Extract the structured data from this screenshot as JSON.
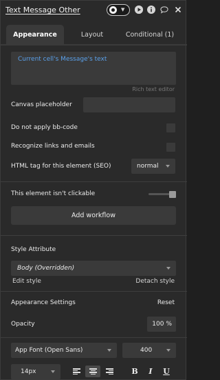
{
  "header": {
    "title": "Text Message Other",
    "icons": [
      "toggle-pill",
      "play-icon",
      "info-icon",
      "comment-icon",
      "close-icon"
    ]
  },
  "tabs": [
    {
      "label": "Appearance",
      "active": true
    },
    {
      "label": "Layout",
      "active": false
    },
    {
      "label": "Conditional (1)",
      "active": false
    }
  ],
  "content": {
    "value": "Current cell's Message's text",
    "editor_link": "Rich text editor"
  },
  "fields": {
    "canvas_placeholder": "Canvas placeholder",
    "no_bbcode": "Do not apply bb-code",
    "recognize_links": "Recognize links and emails",
    "html_tag_label": "HTML tag for this element (SEO)",
    "html_tag_value": "normal"
  },
  "clickable": {
    "label": "This element isn't clickable",
    "add_workflow": "Add workflow"
  },
  "style": {
    "section": "Style Attribute",
    "value": "Body (Overridden)",
    "edit": "Edit style",
    "detach": "Detach style"
  },
  "appearance": {
    "section": "Appearance Settings",
    "reset": "Reset",
    "opacity_label": "Opacity",
    "opacity_value": "100",
    "opacity_unit": "%",
    "font": "App Font (Open Sans)",
    "weight": "400",
    "size": "14px",
    "bold": "B",
    "italic": "I",
    "underline": "U"
  },
  "colors": {
    "panel": "#2a2a2a",
    "field": "#3a3a3a",
    "link": "#5aa0ea"
  }
}
